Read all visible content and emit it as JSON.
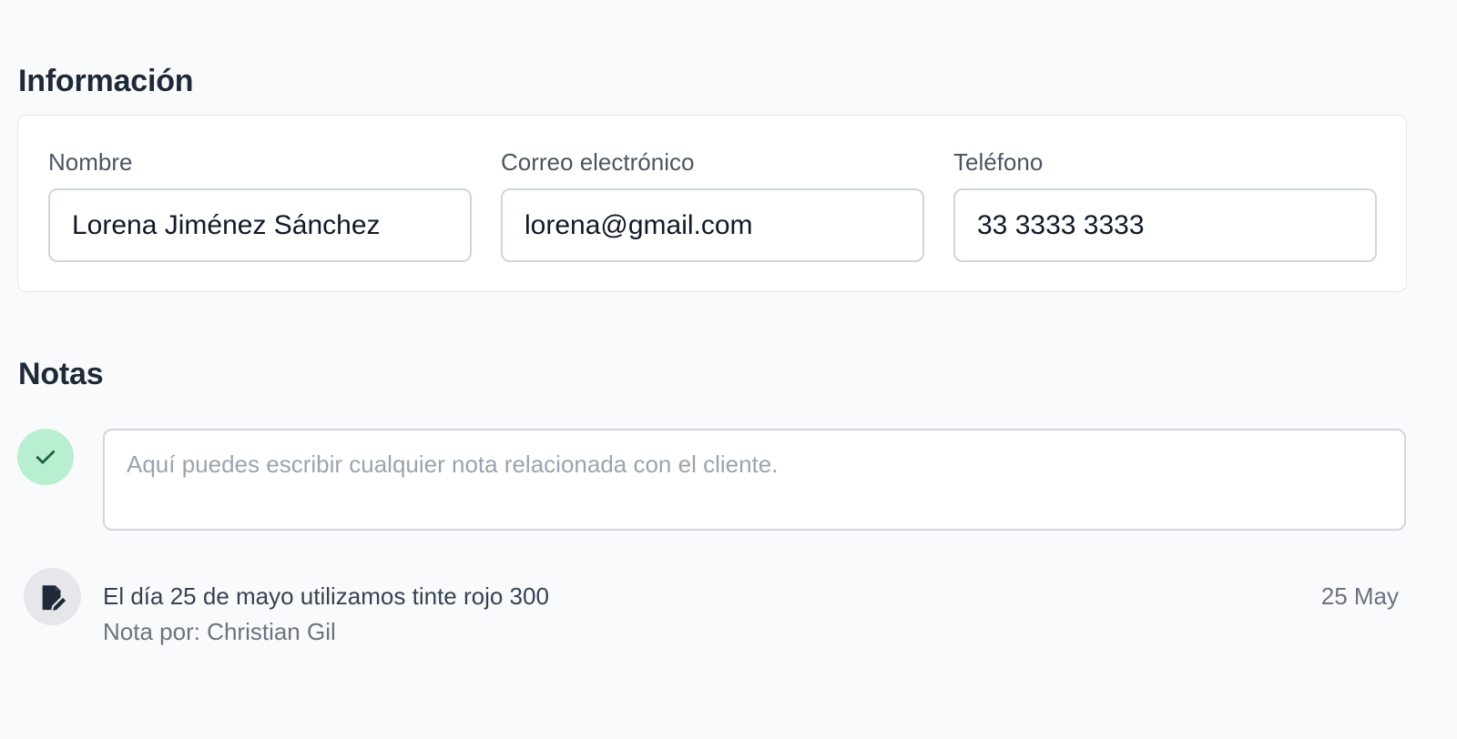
{
  "info": {
    "title": "Información",
    "fields": {
      "name": {
        "label": "Nombre",
        "value": "Lorena Jiménez Sánchez"
      },
      "email": {
        "label": "Correo electrónico",
        "value": "lorena@gmail.com"
      },
      "phone": {
        "label": "Teléfono",
        "value": "33 3333 3333"
      }
    }
  },
  "notes": {
    "title": "Notas",
    "input_placeholder": "Aquí puedes escribir cualquier nota relacionada con el cliente.",
    "items": [
      {
        "text": "El día 25 de mayo utilizamos tinte rojo 300",
        "author": "Nota por: Christian Gil",
        "date": "25 May"
      }
    ]
  },
  "icons": {
    "check": "check-icon",
    "note": "note-edit-icon"
  },
  "colors": {
    "check_bg": "#b8efd0",
    "check_stroke": "#1f5f46",
    "note_icon_bg": "#e5e7eb"
  }
}
